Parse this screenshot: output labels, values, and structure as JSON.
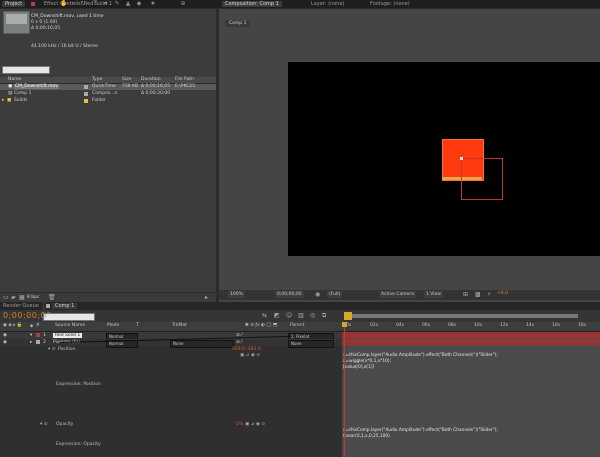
{
  "top_tabs": {
    "project": "Project",
    "effect_controls": "Effect Controls: Red Solid 1",
    "composition": "Composition: Comp 1",
    "layer": "Layer: (none)",
    "footage": "Footage: (none)"
  },
  "project": {
    "file_name": "CM_Downshift.mov",
    "file_used": ", used 1 time",
    "dims": "0 x 0 (1.00)",
    "duration": "Δ 0;00;16;05",
    "audio_info": "44.100 kHz / 16 bit U / Stereo",
    "search_placeholder": "",
    "columns": {
      "name": "Name",
      "type": "Type",
      "size": "Size",
      "duration": "Duration",
      "file_path": "File Path"
    },
    "items": [
      {
        "name": "CM_Downshift.mov",
        "type": "QuickTime",
        "size": "738 KB",
        "duration": "Δ 0;00;16;05",
        "path": "E:\\PKC25",
        "color": "#a9a9a9"
      },
      {
        "name": "Comp 1",
        "type": "Compos...n",
        "size": "",
        "duration": "Δ 0;00;30;00",
        "path": "",
        "color": "#a9a9a9"
      },
      {
        "name": "Solids",
        "type": "Folder",
        "size": "",
        "duration": "",
        "path": "",
        "color": "#e2c23c"
      }
    ],
    "bit_depth": "8 bpc"
  },
  "composition": {
    "sub_tab": "Comp 1",
    "zoom": "100%",
    "timecode": "0;00;00;00",
    "resolution": "(Full)",
    "camera": "Active Camera",
    "views": "1 View",
    "exposure": "+0.0"
  },
  "timeline": {
    "render_queue_tab": "Render Queue",
    "comp_tab": "Comp 1",
    "current_time": "0;00;00;00",
    "columns": {
      "source_name": "Source Name",
      "mode": "Mode",
      "trkmat": "TrkMat",
      "parent": "Parent"
    },
    "layers": [
      {
        "num": "1",
        "name": "Red Solid 1",
        "mode": "Normal",
        "trkmat": "",
        "parent": "2. Pixelat",
        "color": "#b33b3b"
      },
      {
        "num": "2",
        "name": "Pixelate (fx)",
        "mode": "Normal",
        "trkmat": "None",
        "parent": "None",
        "color": "#a9a9a9"
      }
    ],
    "position": {
      "label": "Position",
      "value": "959.0,-483.0",
      "expr_label": "Expression: Position",
      "expr_lines": [
        "x=thisComp.layer(\"Audio Amplitude\").effect(\"Both Channels\")(\"Slider\");",
        "x=wiggle(x*0.1,x*10);",
        "[value[0],x[1]]"
      ]
    },
    "opacity": {
      "label": "Opacity",
      "value": "0%",
      "expr_label": "Expression: Opacity",
      "expr_lines": [
        "x=thisComp.layer(\"Audio Amplitude\").effect(\"Both Channels\")(\"Slider\");",
        "linear(0,1,x,0,25,100)"
      ]
    },
    "ruler": [
      "0s",
      "02s",
      "04s",
      "06s",
      "08s",
      "10s",
      "12s",
      "14s",
      "16s",
      "18s"
    ]
  },
  "colors": {
    "solid_fill": "#ff3a0f",
    "track_bar": "#9a3434",
    "accent_orange": "#e08a2c"
  }
}
